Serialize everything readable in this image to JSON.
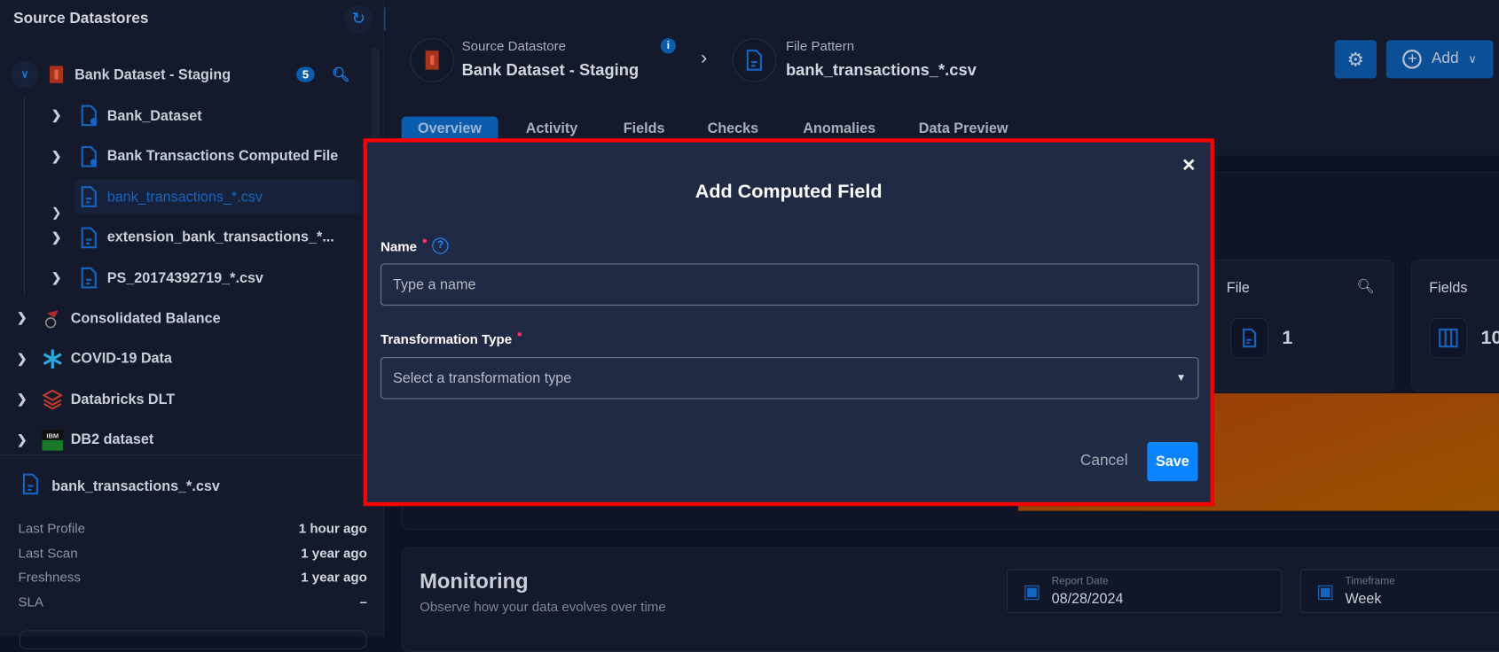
{
  "sidebar": {
    "title": "Source Datastores",
    "datastore": {
      "label": "Bank Dataset - Staging",
      "count": "5"
    },
    "children": [
      {
        "label": "Bank_Dataset",
        "icon": "computed-file-icon"
      },
      {
        "label": "Bank Transactions Computed File",
        "icon": "computed-file-icon"
      },
      {
        "label": "bank_transactions_*.csv",
        "icon": "file-icon",
        "selected": true
      },
      {
        "label": "extension_bank_transactions_*...",
        "icon": "file-icon"
      },
      {
        "label": "PS_20174392719_*.csv",
        "icon": "file-icon"
      }
    ],
    "datastores": [
      {
        "label": "Consolidated Balance",
        "icon": "redshift-icon"
      },
      {
        "label": "COVID-19 Data",
        "icon": "snowflake-icon"
      },
      {
        "label": "Databricks DLT",
        "icon": "databricks-icon"
      },
      {
        "label": "DB2 dataset",
        "icon": "ibm-db2-icon"
      }
    ],
    "details": {
      "file": "bank_transactions_*.csv",
      "rows": [
        {
          "label": "Last Profile",
          "value": "1 hour ago"
        },
        {
          "label": "Last Scan",
          "value": "1 year ago"
        },
        {
          "label": "Freshness",
          "value": "1 year ago"
        },
        {
          "label": "SLA",
          "value": "–"
        }
      ]
    }
  },
  "header": {
    "datastore_label": "Source Datastore",
    "datastore_name": "Bank Dataset - Staging",
    "pattern_label": "File Pattern",
    "pattern_name": "bank_transactions_*.csv",
    "add_label": "Add"
  },
  "tabs": [
    "Overview",
    "Activity",
    "Fields",
    "Checks",
    "Anomalies",
    "Data Preview"
  ],
  "cards": {
    "file_label": "File",
    "file_value": "1",
    "fields_label": "Fields",
    "fields_value": "10"
  },
  "monitoring": {
    "title": "Monitoring",
    "subtitle": "Observe how your data evolves over time",
    "report_date_label": "Report Date",
    "report_date": "08/28/2024",
    "timeframe_label": "Timeframe",
    "timeframe": "Week"
  },
  "modal": {
    "title": "Add Computed Field",
    "name_label": "Name",
    "name_placeholder": "Type a name",
    "type_label": "Transformation Type",
    "type_placeholder": "Select a transformation type",
    "cancel": "Cancel",
    "save": "Save"
  },
  "colors": {
    "accent": "#0b5cad",
    "save": "#0a84ff",
    "highlight": "#ff0000",
    "required": "#ff2d6a"
  }
}
